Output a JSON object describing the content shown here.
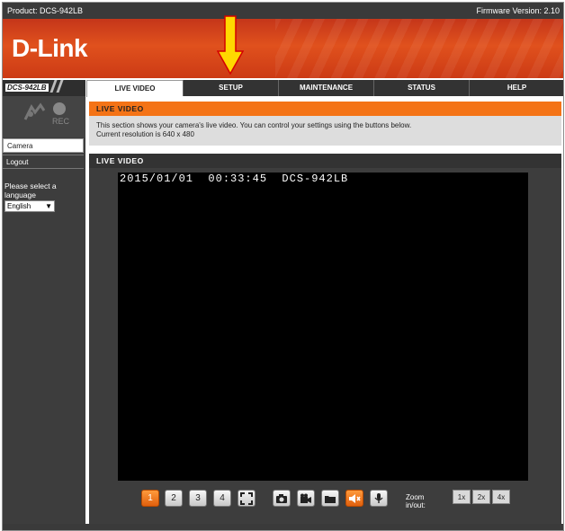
{
  "topbar": {
    "product": "Product: DCS-942LB",
    "firmware": "Firmware Version: 2.10"
  },
  "brand": {
    "logo": "D-Link"
  },
  "nav": {
    "model": "DCS-942LB",
    "tabs": [
      {
        "label": "LIVE VIDEO",
        "active": true
      },
      {
        "label": "SETUP",
        "active": false
      },
      {
        "label": "MAINTENANCE",
        "active": false
      },
      {
        "label": "STATUS",
        "active": false
      },
      {
        "label": "HELP",
        "active": false
      }
    ]
  },
  "sidebar": {
    "snapshot_icon": "snapshot-icon",
    "rec_label": "REC",
    "items": [
      {
        "label": "Camera"
      },
      {
        "label": "Logout"
      }
    ],
    "language_prompt": "Please select a language",
    "language_value": "English"
  },
  "main": {
    "section_title": "LIVE VIDEO",
    "description": "This section shows your camera's live video. You can control your settings using the buttons below.",
    "resolution": "Current resolution is 640 x 480",
    "video_title": "LIVE VIDEO",
    "osd": "2015/01/01  00:33:45  DCS-942LB",
    "controls": [
      "1",
      "2",
      "3",
      "4"
    ],
    "zoom_label": "Zoom in/out:",
    "zoom_levels": [
      "1x",
      "2x",
      "4x"
    ]
  },
  "colors": {
    "accent": "#f47316",
    "arrow": "#ffd800",
    "dark": "#3d3d3d"
  }
}
